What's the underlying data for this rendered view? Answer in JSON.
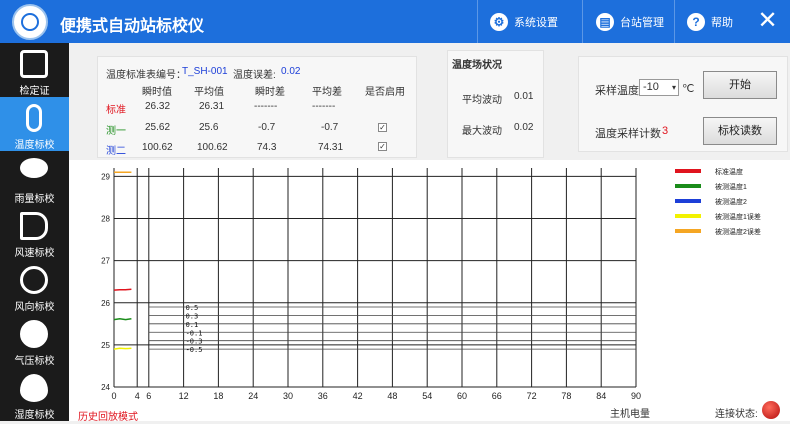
{
  "header": {
    "title": "便携式自动站标校仪",
    "buttons": [
      {
        "label": "系统设置",
        "icon": "gear-icon"
      },
      {
        "label": "台站管理",
        "icon": "station-icon"
      },
      {
        "label": "帮助",
        "icon": "help-icon"
      }
    ],
    "close_icon": "close-icon"
  },
  "sidebar": {
    "items": [
      {
        "label": "检定证",
        "icon": "certificate-icon",
        "active": false
      },
      {
        "label": "温度标校",
        "icon": "thermometer-icon",
        "active": true
      },
      {
        "label": "雨量标校",
        "icon": "rain-icon",
        "active": false
      },
      {
        "label": "风速标校",
        "icon": "windsock-icon",
        "active": false
      },
      {
        "label": "风向标校",
        "icon": "wind-direction-icon",
        "active": false
      },
      {
        "label": "气压标校",
        "icon": "pressure-gauge-icon",
        "active": false
      },
      {
        "label": "湿度标校",
        "icon": "humidity-drop-icon",
        "active": false
      }
    ]
  },
  "std_table": {
    "id_label": "温度标准表编号：",
    "id_value": "T_SH-001",
    "error_label": "温度误差:",
    "error_value": "0.02",
    "columns": [
      "瞬时值",
      "平均值",
      "瞬时差",
      "平均差",
      "是否启用"
    ],
    "rows": [
      {
        "name": "标准",
        "instant": "26.32",
        "avg": "26.31",
        "instant_diff": "-------",
        "avg_diff": "-------",
        "enabled": null
      },
      {
        "name": "测一",
        "instant": "25.62",
        "avg": "25.6",
        "instant_diff": "-0.7",
        "avg_diff": "-0.7",
        "enabled": true
      },
      {
        "name": "测二",
        "instant": "100.62",
        "avg": "100.62",
        "instant_diff": "74.3",
        "avg_diff": "74.31",
        "enabled": true
      }
    ]
  },
  "field_status": {
    "title": "温度场状况",
    "avg_fluct_label": "平均波动",
    "avg_fluct_value": "0.01",
    "max_fluct_label": "最大波动",
    "max_fluct_value": "0.02"
  },
  "sampling": {
    "temp_label": "采样温度",
    "temp_value": "-10",
    "unit": "℃",
    "start_button": "开始",
    "count_label": "温度采样计数",
    "count_value": "3",
    "read_button": "标校读数"
  },
  "chart_data": {
    "type": "line",
    "x_ticks": [
      0,
      4,
      6,
      12,
      18,
      24,
      30,
      36,
      42,
      48,
      54,
      60,
      66,
      72,
      78,
      84,
      90
    ],
    "y_ticks": [
      24,
      25,
      26,
      27,
      28,
      29
    ],
    "xlim": [
      0,
      90
    ],
    "ylim": [
      24,
      29.2
    ],
    "grid": true,
    "series": [
      {
        "name": "标准温度",
        "color": "#e0141e",
        "x": [
          0,
          1,
          2,
          3
        ],
        "y": [
          26.3,
          26.31,
          26.31,
          26.32
        ]
      },
      {
        "name": "被测温度1",
        "color": "#1a8c1a",
        "x": [
          0,
          1,
          2,
          3
        ],
        "y": [
          25.6,
          25.62,
          25.6,
          25.62
        ]
      },
      {
        "name": "被测温度2",
        "color": "#1d3fd8",
        "x": [],
        "y": []
      },
      {
        "name": "被测温度1误差",
        "color": "#f2f200",
        "x": [
          0,
          1,
          2,
          3
        ],
        "y": [
          24.9,
          24.92,
          24.91,
          24.92
        ]
      },
      {
        "name": "被测温度2误差",
        "color": "#f5a623",
        "x": [
          0,
          1,
          2,
          3
        ],
        "y": [
          29.1,
          29.1,
          29.1,
          29.1
        ]
      }
    ],
    "reference_lines": [
      {
        "label": "0.5",
        "y": 25.9
      },
      {
        "label": "0.3",
        "y": 25.7
      },
      {
        "label": "0.1",
        "y": 25.5
      },
      {
        "label": "-0.1",
        "y": 25.3
      },
      {
        "label": "-0.3",
        "y": 25.1
      },
      {
        "label": "-0.5",
        "y": 24.9
      }
    ]
  },
  "footer": {
    "mode_label": "历史回放模式",
    "battery_label": "主机电量",
    "connection_label": "连接状态:"
  }
}
